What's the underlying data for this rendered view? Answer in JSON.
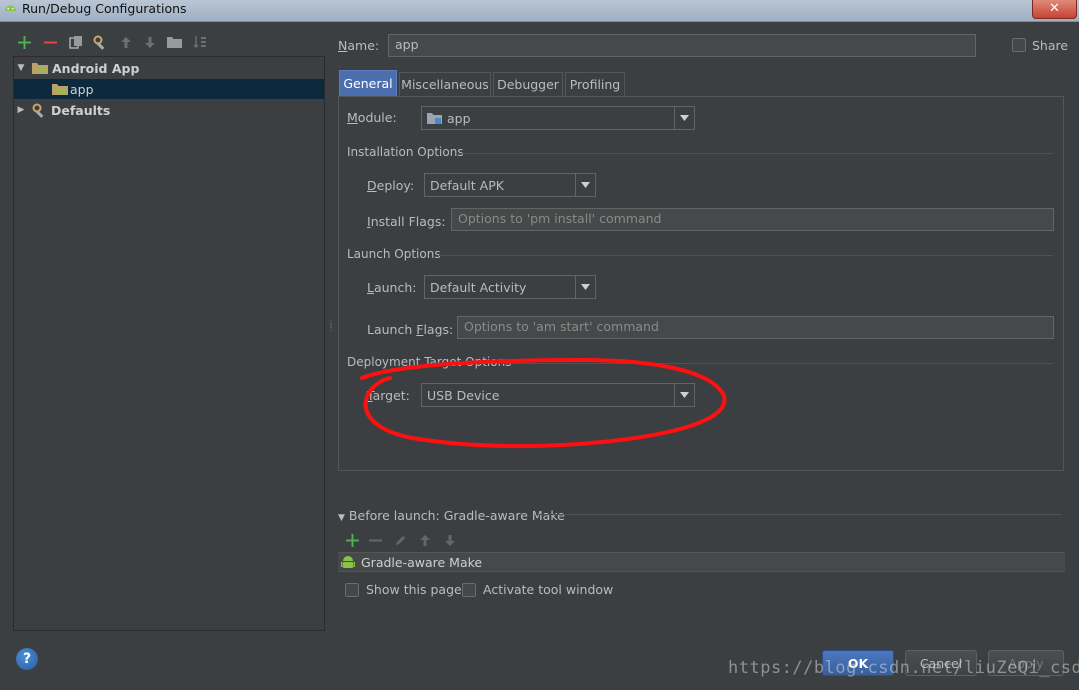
{
  "window": {
    "title": "Run/Debug Configurations",
    "close": "✕"
  },
  "tree": {
    "items": [
      {
        "label": "Android App",
        "expanded": true
      },
      {
        "label": "app"
      },
      {
        "label": "Defaults",
        "expanded": false
      }
    ]
  },
  "form": {
    "name_label": "Name:",
    "name_value": "app",
    "share_label": "Share",
    "tabs": [
      "General",
      "Miscellaneous",
      "Debugger",
      "Profiling"
    ],
    "module_label": "Module:",
    "module_value": "app",
    "installation_title": "Installation Options",
    "deploy_label": "Deploy:",
    "deploy_value": "Default APK",
    "install_flags_label": "Install Flags:",
    "install_flags_placeholder": "Options to 'pm install' command",
    "launch_title": "Launch Options",
    "launch_label": "Launch:",
    "launch_value": "Default Activity",
    "launch_flags_label": "Launch Flags:",
    "launch_flags_placeholder": "Options to 'am start' command",
    "deployment_title": "Deployment Target Options",
    "target_label": "Target:",
    "target_value": "USB Device"
  },
  "before_launch": {
    "title": "Before launch: Gradle-aware Make",
    "item": "Gradle-aware Make",
    "show_page": "Show this page",
    "activate_tool": "Activate tool window"
  },
  "buttons": {
    "help": "?",
    "ok": "OK",
    "cancel": "Cancel",
    "apply": "Apply"
  },
  "watermark": "https://blog.csdn.net/liuZeQi_csdn",
  "colors": {
    "accent": "#4b6eaf",
    "selection": "#0d293e",
    "annotation": "#ff1010",
    "add": "#4caf50",
    "remove": "#e04a3a"
  }
}
